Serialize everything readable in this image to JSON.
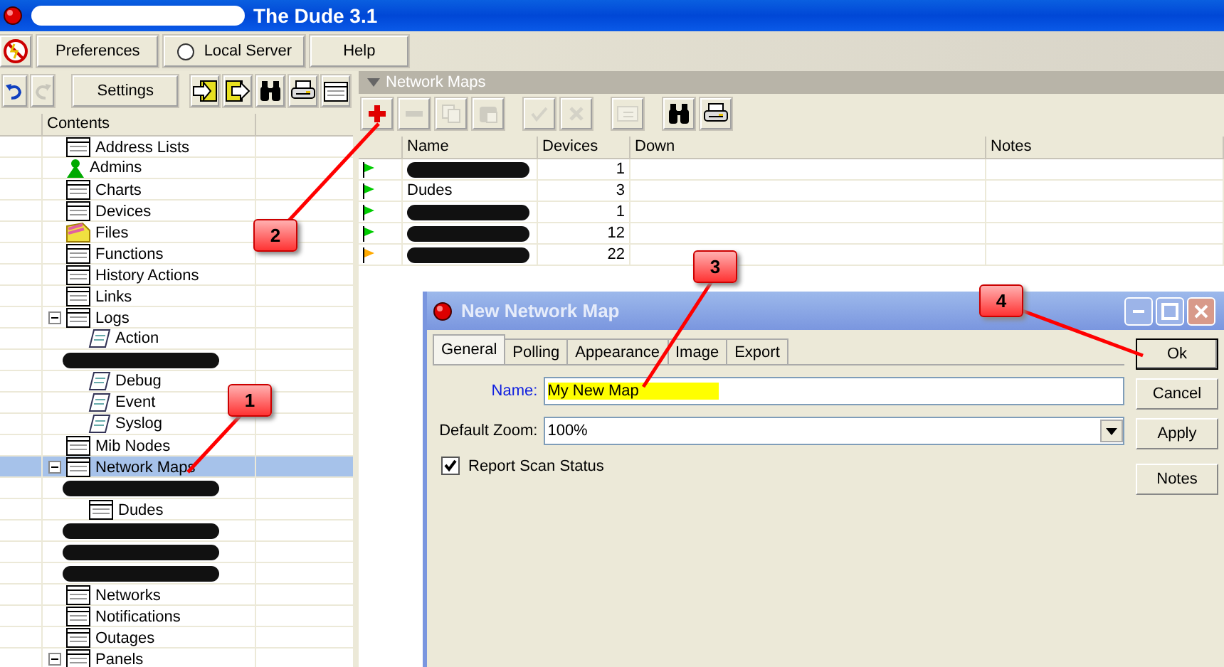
{
  "window": {
    "title": "The Dude 3.1",
    "title_redacted": true
  },
  "main_toolbar": {
    "buttons": [
      {
        "kind": "stop"
      },
      {
        "kind": "text",
        "label": "Preferences"
      },
      {
        "kind": "radio",
        "label": "Local Server",
        "on": false
      },
      {
        "kind": "text",
        "label": "Help"
      }
    ]
  },
  "secondary_toolbar": {
    "buttons": [
      {
        "kind": "undo",
        "disabled": false
      },
      {
        "kind": "redo",
        "disabled": true
      },
      {
        "kind": "text",
        "label": "Settings"
      },
      {
        "kind": "export",
        "disabled": false
      },
      {
        "kind": "import",
        "disabled": false
      },
      {
        "kind": "find",
        "disabled": false
      },
      {
        "kind": "print",
        "disabled": false
      },
      {
        "kind": "table",
        "disabled": false
      }
    ]
  },
  "sidebar": {
    "header": "Contents",
    "items": [
      {
        "label": "Address Lists",
        "kind": "table",
        "selected": false
      },
      {
        "label": "Admins",
        "kind": "user",
        "selected": false
      },
      {
        "label": "Charts",
        "kind": "table",
        "selected": false
      },
      {
        "label": "Devices",
        "kind": "table",
        "selected": false
      },
      {
        "label": "Files",
        "kind": "files",
        "selected": false
      },
      {
        "label": "Functions",
        "kind": "table",
        "selected": false
      },
      {
        "label": "History Actions",
        "kind": "table",
        "selected": false
      },
      {
        "label": "Links",
        "kind": "table",
        "selected": false
      },
      {
        "label": "Logs",
        "kind": "table",
        "selected": false,
        "expanded": true,
        "children": [
          {
            "label": "Action",
            "kind": "log",
            "selected": false
          },
          {
            "kind": "redacted",
            "selected": false
          },
          {
            "label": "Debug",
            "kind": "log",
            "selected": false
          },
          {
            "label": "Event",
            "kind": "log",
            "selected": false
          },
          {
            "label": "Syslog",
            "kind": "log",
            "selected": false
          }
        ]
      },
      {
        "label": "Mib Nodes",
        "kind": "table",
        "selected": false
      },
      {
        "label": "Network Maps",
        "kind": "table",
        "selected": true,
        "expanded": true,
        "children": [
          {
            "kind": "redacted",
            "selected": false
          },
          {
            "label": "Dudes",
            "kind": "table",
            "selected": false
          },
          {
            "kind": "redacted",
            "selected": false
          },
          {
            "kind": "redacted",
            "selected": false
          },
          {
            "kind": "redacted",
            "selected": false
          }
        ]
      },
      {
        "label": "Networks",
        "kind": "table",
        "selected": false
      },
      {
        "label": "Notifications",
        "kind": "table",
        "selected": false
      },
      {
        "label": "Outages",
        "kind": "table",
        "selected": false
      },
      {
        "label": "Panels",
        "kind": "table",
        "selected": false,
        "expanded": true
      }
    ]
  },
  "panel": {
    "title": "Network Maps",
    "toolbar": [
      {
        "kind": "add",
        "disabled": false
      },
      {
        "kind": "remove",
        "disabled": true
      },
      {
        "kind": "copy",
        "disabled": true
      },
      {
        "kind": "paste",
        "disabled": true
      },
      {
        "kind": "enable",
        "disabled": true
      },
      {
        "kind": "disable",
        "disabled": true
      },
      {
        "kind": "note",
        "disabled": true
      },
      {
        "kind": "find",
        "disabled": false
      },
      {
        "kind": "print",
        "disabled": false
      }
    ],
    "table": {
      "columns": [
        "Name",
        "Devices",
        "Down",
        "Notes"
      ],
      "rows": [
        {
          "color": "#00cc00",
          "name_redacted": true,
          "devices": "1"
        },
        {
          "color": "#00cc00",
          "name": "Dudes",
          "devices": "3"
        },
        {
          "color": "#00cc00",
          "name_redacted": true,
          "devices": "1"
        },
        {
          "color": "#00cc00",
          "name_redacted": true,
          "devices": "12"
        },
        {
          "color": "#ffaa00",
          "name_redacted": true,
          "devices": "22"
        }
      ]
    }
  },
  "dialog": {
    "title": "New Network Map",
    "tabs": [
      {
        "label": "General",
        "selected": true
      },
      {
        "label": "Polling",
        "selected": false
      },
      {
        "label": "Appearance",
        "selected": false
      },
      {
        "label": "Image",
        "selected": false
      },
      {
        "label": "Export",
        "selected": false
      }
    ],
    "name_label": "Name:",
    "name_value": "My New Map",
    "name_highlighted": true,
    "zoom_label": "Default Zoom:",
    "zoom_value": "100%",
    "report_scan_status": {
      "label": "Report Scan Status",
      "checked": true
    },
    "buttons": [
      {
        "label": "Ok",
        "default": true
      },
      {
        "label": "Cancel",
        "default": false
      },
      {
        "label": "Apply",
        "default": false
      },
      {
        "label": "Notes",
        "default": false
      }
    ]
  },
  "annotations": [
    {
      "number": "1"
    },
    {
      "number": "2"
    },
    {
      "number": "3"
    },
    {
      "number": "4"
    }
  ]
}
